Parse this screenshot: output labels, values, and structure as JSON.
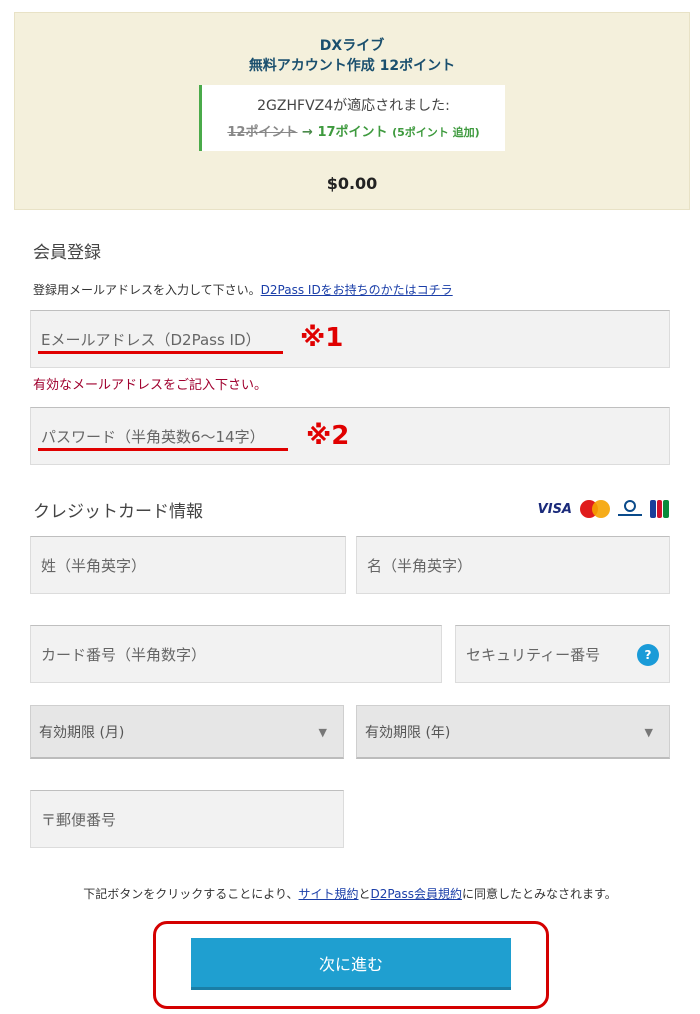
{
  "summary": {
    "title": "DXライブ",
    "subtitle": "無料アカウント作成 12ポイント",
    "promo_applied": "2GZHFVZ4が適応されました:",
    "old_points": "12ポイント",
    "arrow": "→",
    "new_points": "17ポイント",
    "bonus": "(5ポイント 追加)",
    "price": "$0.00"
  },
  "registration": {
    "title": "会員登録",
    "hint": "登録用メールアドレスを入力して下さい。",
    "hint_link": "D2Pass IDをお持ちのかたはコチラ",
    "email_placeholder": "Eメールアドレス（D2Pass ID）",
    "email_mark": "※1",
    "email_error": "有効なメールアドレスをご記入下さい。",
    "password_placeholder": "パスワード（半角英数6～14字）",
    "password_mark": "※2"
  },
  "credit": {
    "title": "クレジットカード情報",
    "card_brands": [
      "VISA",
      "MasterCard",
      "Diners Club International",
      "JCB"
    ],
    "visa_label": "VISA",
    "last_name": "姓（半角英字）",
    "first_name": "名（半角英字）",
    "card_number": "カード番号（半角数字）",
    "security_code": "セキュリティー番号",
    "help": "?",
    "exp_month": "有効期限 (月)",
    "exp_year": "有効期限 (年)",
    "caret": "▼",
    "postal": "〒郵便番号"
  },
  "agreement": {
    "before": "下記ボタンをクリックすることにより、",
    "site_terms": "サイト規約",
    "and": "と",
    "member_terms": "D2Pass会員規約",
    "after": "に同意したとみなされます。"
  },
  "submit_label": "次に進む",
  "colors": {
    "accent": "#1f9fd0",
    "annotation_red": "#e00000",
    "error": "#a0002e",
    "promo_green": "#3e9a3e",
    "summary_bg": "#f4f0dc"
  }
}
